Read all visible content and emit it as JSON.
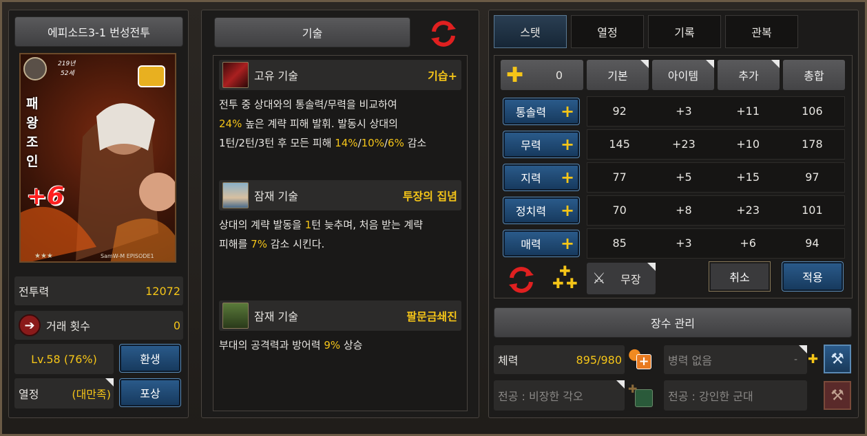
{
  "episode_title": "에피소드3-1 번성전투",
  "card": {
    "name": "패왕 조인",
    "year_text": "219년",
    "age_text": "52세",
    "plus": "+6",
    "stars": "★★★",
    "brand": "SamW-M EPISODE1"
  },
  "left": {
    "power_label": "전투력",
    "power_value": "12072",
    "trade_label": "거래 횟수",
    "trade_value": "0",
    "level_text": "Lv.58 (76%)",
    "rebirth_button": "환생",
    "passion_label": "열정",
    "passion_value": "(대만족)",
    "reward_button": "포상"
  },
  "skills": {
    "header": "기술",
    "items": [
      {
        "type": "고유 기술",
        "name": "기습+",
        "desc_lines": [
          [
            {
              "t": "전투 중 상대와의 통솔력/무력을 비교하여"
            }
          ],
          [
            {
              "t": "24%",
              "hl": true
            },
            {
              "t": " 높은 계략 피해 발휘. 발동시 상대의"
            }
          ],
          [
            {
              "t": "1턴/2턴/3턴 후 모든 피해 "
            },
            {
              "t": "14%",
              "hl": true
            },
            {
              "t": "/"
            },
            {
              "t": "10%",
              "hl": true
            },
            {
              "t": "/"
            },
            {
              "t": "6%",
              "hl": true
            },
            {
              "t": " 감소"
            }
          ]
        ]
      },
      {
        "type": "잠재 기술",
        "name": "투장의 집념",
        "desc_lines": [
          [
            {
              "t": "상대의 계략 발동을 "
            },
            {
              "t": "1",
              "hl": true
            },
            {
              "t": "턴 늦추며, 처음 받는 계략"
            }
          ],
          [
            {
              "t": "피해를 "
            },
            {
              "t": "7%",
              "hl": true
            },
            {
              "t": " 감소 시킨다."
            }
          ]
        ]
      },
      {
        "type": "잠재 기술",
        "name": "팔문금쇄진",
        "desc_lines": [
          [
            {
              "t": "부대의 공격력과 방어력 "
            },
            {
              "t": "9%",
              "hl": true
            },
            {
              "t": " 상승"
            }
          ]
        ]
      }
    ]
  },
  "tabs": [
    "스탯",
    "열정",
    "기록",
    "관복"
  ],
  "stats": {
    "points": "0",
    "columns": [
      "기본",
      "아이템",
      "추가",
      "총합"
    ],
    "rows": [
      {
        "label": "통솔력",
        "values": [
          "92",
          "+3",
          "+11",
          "106"
        ]
      },
      {
        "label": "무력",
        "values": [
          "145",
          "+23",
          "+10",
          "178"
        ]
      },
      {
        "label": "지력",
        "values": [
          "77",
          "+5",
          "+15",
          "97"
        ]
      },
      {
        "label": "정치력",
        "values": [
          "70",
          "+8",
          "+23",
          "101"
        ]
      },
      {
        "label": "매력",
        "values": [
          "85",
          "+3",
          "+6",
          "94"
        ]
      }
    ],
    "class_label": "무장",
    "cancel_button": "취소",
    "apply_button": "적용"
  },
  "general": {
    "header": "장수 관리",
    "hp_label": "체력",
    "hp_value": "895/980",
    "troops_text": "병력 없음",
    "troops_dash": "-",
    "merit1": "전공 : 비장한 각오",
    "merit2": "전공 : 강인한 군대"
  },
  "colors": {
    "highlight": "#f5c518",
    "blue_button": "#1f4a75",
    "background": "#1c1b1a"
  }
}
